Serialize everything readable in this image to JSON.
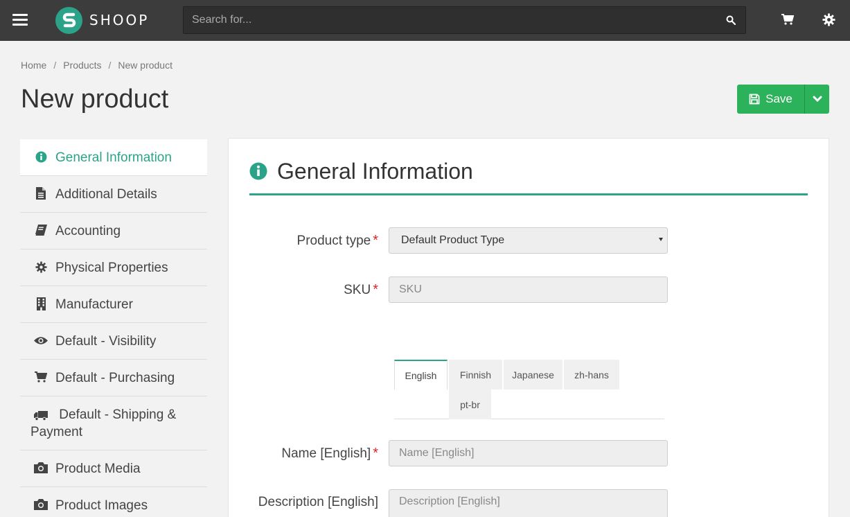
{
  "header": {
    "logo_text": "SHOOP",
    "search_placeholder": "Search for...",
    "icons": [
      "menu-icon",
      "search-icon",
      "cart-icon",
      "gear-icon"
    ]
  },
  "breadcrumb": [
    "Home",
    "Products",
    "New product"
  ],
  "page_title": "New product",
  "save": {
    "label": "Save"
  },
  "sidebar": {
    "items": [
      {
        "label": "General Information",
        "icon": "info-icon",
        "active": true
      },
      {
        "label": "Additional Details",
        "icon": "file-icon"
      },
      {
        "label": "Accounting",
        "icon": "book-icon"
      },
      {
        "label": "Physical Properties",
        "icon": "gear-icon"
      },
      {
        "label": "Manufacturer",
        "icon": "building-icon"
      },
      {
        "label": "Default - Visibility",
        "icon": "eye-icon"
      },
      {
        "label": "Default - Purchasing",
        "icon": "cart-icon"
      },
      {
        "label": "Default - Shipping & Payment",
        "icon": "truck-icon"
      },
      {
        "label": "Product Media",
        "icon": "camera-icon"
      },
      {
        "label": "Product Images",
        "icon": "camera-icon"
      }
    ]
  },
  "panel": {
    "title": "General Information",
    "product_type": {
      "label": "Product type",
      "value": "Default Product Type"
    },
    "sku": {
      "label": "SKU",
      "placeholder": "SKU"
    },
    "language_tabs": [
      "English",
      "Finnish",
      "Japanese",
      "zh-hans",
      "pt-br"
    ],
    "name": {
      "label": "Name [English]",
      "placeholder": "Name [English]"
    },
    "description": {
      "label": "Description [English]",
      "placeholder": "Description [English]"
    }
  },
  "colors": {
    "accent": "#2aa389",
    "save_green": "#2bb25a",
    "topbar": "#3c3c3c",
    "required": "#e02424"
  }
}
